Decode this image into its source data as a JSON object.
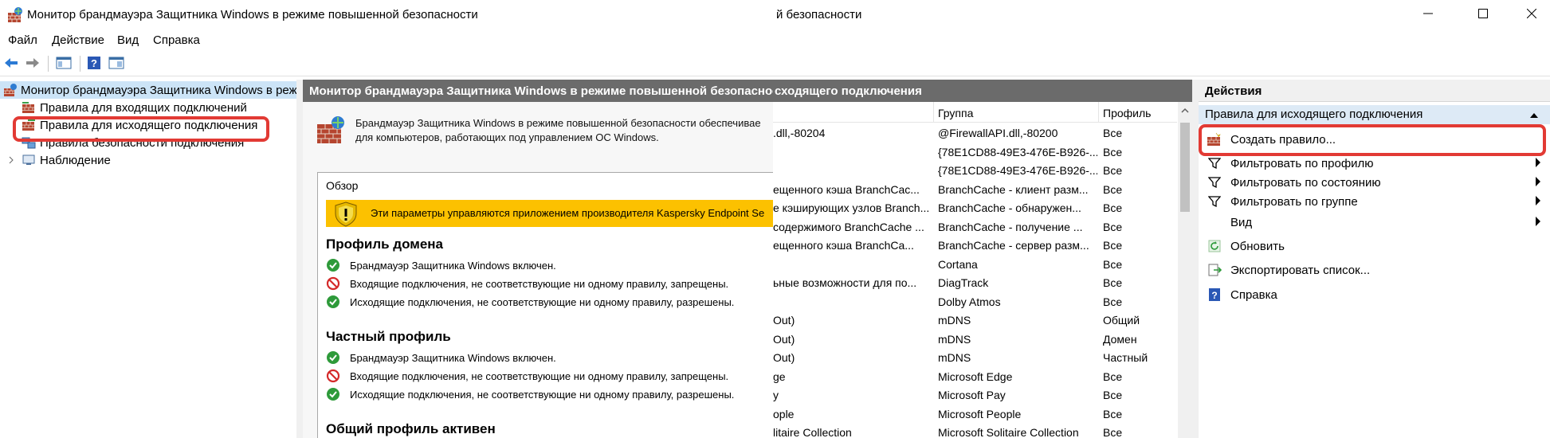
{
  "window": {
    "title": "Монитор брандмауэра Защитника Windows в режиме повышенной безопасности",
    "title_fragment": "й безопасности"
  },
  "menu": [
    "Файл",
    "Действие",
    "Вид",
    "Справка"
  ],
  "tree": {
    "root": "Монитор брандмауэра Защитника Windows в режи",
    "items": [
      {
        "label": "Правила для входящих подключений",
        "icon": "inbound-rules-icon"
      },
      {
        "label": "Правила для исходящего подключения",
        "icon": "outbound-rules-icon"
      },
      {
        "label": "Правила безопасности подключения",
        "icon": "connection-security-icon"
      },
      {
        "label": "Наблюдение",
        "icon": "monitoring-icon"
      }
    ]
  },
  "middle": {
    "header": "Монитор брандмауэра Защитника Windows в режиме повышенной безопасности",
    "intro_line1": "Брандмауэр Защитника Windows в режиме повышенной безопасности обеспечивае",
    "intro_line2": "для компьютеров, работающих под управлением ОС Windows.",
    "overview_label": "Обзор",
    "warning": "Эти параметры управляются приложением производителя Kaspersky Endpoint Se",
    "profiles": [
      {
        "title": "Профиль домена",
        "lines": [
          {
            "status": "allow",
            "text": "Брандмауэр Защитника Windows включен."
          },
          {
            "status": "block",
            "text": "Входящие подключения, не соответствующие ни одному правилу, запрещены."
          },
          {
            "status": "allow",
            "text": "Исходящие подключения, не соответствующие ни одному правилу, разрешены."
          }
        ]
      },
      {
        "title": "Частный профиль",
        "lines": [
          {
            "status": "allow",
            "text": "Брандмауэр Защитника Windows включен."
          },
          {
            "status": "block",
            "text": "Входящие подключения, не соответствующие ни одному правилу, запрещены."
          },
          {
            "status": "allow",
            "text": "Исходящие подключения, не соответствующие ни одному правилу, разрешены."
          }
        ]
      },
      {
        "title": "Общий профиль активен",
        "lines": []
      }
    ]
  },
  "rules_list": {
    "header_fragment": "сходящего подключения",
    "columns": [
      "Группа",
      "Профиль"
    ],
    "rows": [
      {
        "name": ".dll,-80204",
        "group": "@FirewallAPI.dll,-80200",
        "profile": "Все"
      },
      {
        "name": "",
        "group": "{78E1CD88-49E3-476E-B926-...",
        "profile": "Все"
      },
      {
        "name": "",
        "group": "{78E1CD88-49E3-476E-B926-...",
        "profile": "Все"
      },
      {
        "name": "ещенного кэша BranchCac...",
        "group": "BranchCache - клиент разм...",
        "profile": "Все"
      },
      {
        "name": "е кэширующих узлов Branch...",
        "group": "BranchCache - обнаружен...",
        "profile": "Все"
      },
      {
        "name": "содержимого BranchCache ...",
        "group": "BranchCache - получение ...",
        "profile": "Все"
      },
      {
        "name": "ещенного кэша BranchCa...",
        "group": "BranchCache - сервер разм...",
        "profile": "Все"
      },
      {
        "name": "",
        "group": "Cortana",
        "profile": "Все"
      },
      {
        "name": "ьные возможности для по...",
        "group": "DiagTrack",
        "profile": "Все"
      },
      {
        "name": "",
        "group": "Dolby Atmos",
        "profile": "Все"
      },
      {
        "name": "Out)",
        "group": "mDNS",
        "profile": "Общий"
      },
      {
        "name": "Out)",
        "group": "mDNS",
        "profile": "Домен"
      },
      {
        "name": "Out)",
        "group": "mDNS",
        "profile": "Частный"
      },
      {
        "name": "ge",
        "group": "Microsoft Edge",
        "profile": "Все"
      },
      {
        "name": "y",
        "group": "Microsoft Pay",
        "profile": "Все"
      },
      {
        "name": "ople",
        "group": "Microsoft People",
        "profile": "Все"
      },
      {
        "name": "litaire Collection",
        "group": "Microsoft Solitaire Collection",
        "profile": "Все"
      }
    ]
  },
  "actions": {
    "title": "Действия",
    "section": "Правила для исходящего подключения",
    "items": [
      {
        "label": "Создать правило...",
        "icon": "new-rule-icon",
        "submenu": false
      },
      {
        "label": "Фильтровать по профилю",
        "icon": "filter-icon",
        "submenu": true
      },
      {
        "label": "Фильтровать по состоянию",
        "icon": "filter-icon",
        "submenu": true
      },
      {
        "label": "Фильтровать по группе",
        "icon": "filter-icon",
        "submenu": true
      },
      {
        "label": "Вид",
        "icon": "",
        "submenu": true
      },
      {
        "label": "Обновить",
        "icon": "refresh-icon",
        "submenu": false
      },
      {
        "label": "Экспортировать список...",
        "icon": "export-icon",
        "submenu": false
      },
      {
        "label": "Справка",
        "icon": "help-icon",
        "submenu": false
      }
    ]
  },
  "colors": {
    "highlight": "#e23a34",
    "warning_bar": "#fcc100",
    "header_bar": "#6b6b6b",
    "selection": "#cce4f7"
  }
}
